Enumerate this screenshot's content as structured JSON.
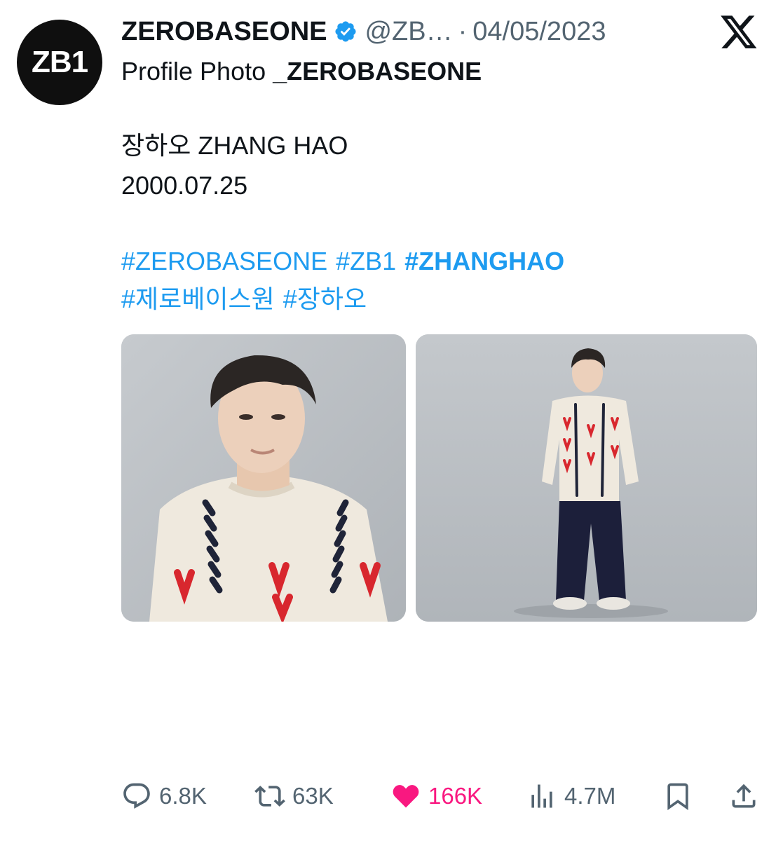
{
  "account": {
    "avatar_text": "ZB1",
    "display_name": "ZEROBASEONE",
    "handle": "@ZB…",
    "separator": "·",
    "date": "04/05/2023",
    "verified_icon": "verified-badge-icon",
    "platform_icon": "x-logo-icon"
  },
  "tweet": {
    "line1_prefix": "Profile Photo ",
    "line1_bold": "_ZEROBASEONE",
    "name_line": "장하오 ZHANG HAO",
    "birthdate": "2000.07.25",
    "hashtags_row1": [
      "#ZEROBASEONE",
      "#ZB1"
    ],
    "hashtag_highlight": "#ZHANGHAO",
    "hashtags_row2": [
      "#제로베이스원",
      "#장하오"
    ]
  },
  "media": {
    "count": 2
  },
  "actions": {
    "replies": "6.8K",
    "reposts": "63K",
    "likes": "166K",
    "views": "4.7M"
  },
  "colors": {
    "link": "#1d9bf0",
    "like": "#f91880",
    "muted": "#536471",
    "text": "#0f1419",
    "verified": "#1d9bf0"
  }
}
